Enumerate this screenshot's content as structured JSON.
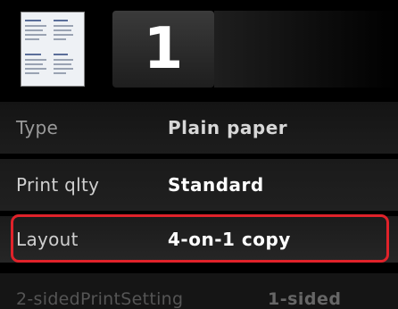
{
  "preview": {
    "copies": "1"
  },
  "settings": [
    {
      "label": "Type",
      "value": "Plain paper"
    },
    {
      "label": "Print qlty",
      "value": "Standard"
    },
    {
      "label": "Layout",
      "value": "4-on-1 copy"
    },
    {
      "label": "2-sidedPrintSetting",
      "value": "1-sided"
    }
  ],
  "colors": {
    "selection_border": "#e0222a",
    "background": "#000000"
  }
}
